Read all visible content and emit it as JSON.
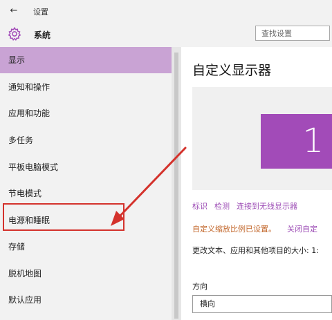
{
  "window": {
    "back_glyph": "←",
    "title": "设置"
  },
  "header": {
    "app_title": "系统",
    "icon": "gear-icon"
  },
  "search": {
    "placeholder": "查找设置"
  },
  "sidebar": {
    "items": [
      {
        "label": "显示",
        "active": true
      },
      {
        "label": "通知和操作"
      },
      {
        "label": "应用和功能"
      },
      {
        "label": "多任务"
      },
      {
        "label": "平板电脑模式"
      },
      {
        "label": "节电模式"
      },
      {
        "label": "电源和睡眠",
        "highlighted": true
      },
      {
        "label": "存储"
      },
      {
        "label": "脱机地图"
      },
      {
        "label": "默认应用"
      }
    ]
  },
  "main": {
    "title": "自定义显示器",
    "monitor_number": "1",
    "links": [
      "标识",
      "检测",
      "连接到无线显示器"
    ],
    "scaling_warning": "自定义缩放比例已设置。",
    "scaling_turnoff": "关闭自定",
    "size_label": "更改文本、应用和其他项目的大小: 1:",
    "orientation_label": "方向",
    "orientation_value": "横向"
  },
  "colors": {
    "accent": "#a24bb8",
    "active_nav": "#c9a3d4",
    "annotation_red": "#d4322c",
    "warning": "#c2662a"
  }
}
